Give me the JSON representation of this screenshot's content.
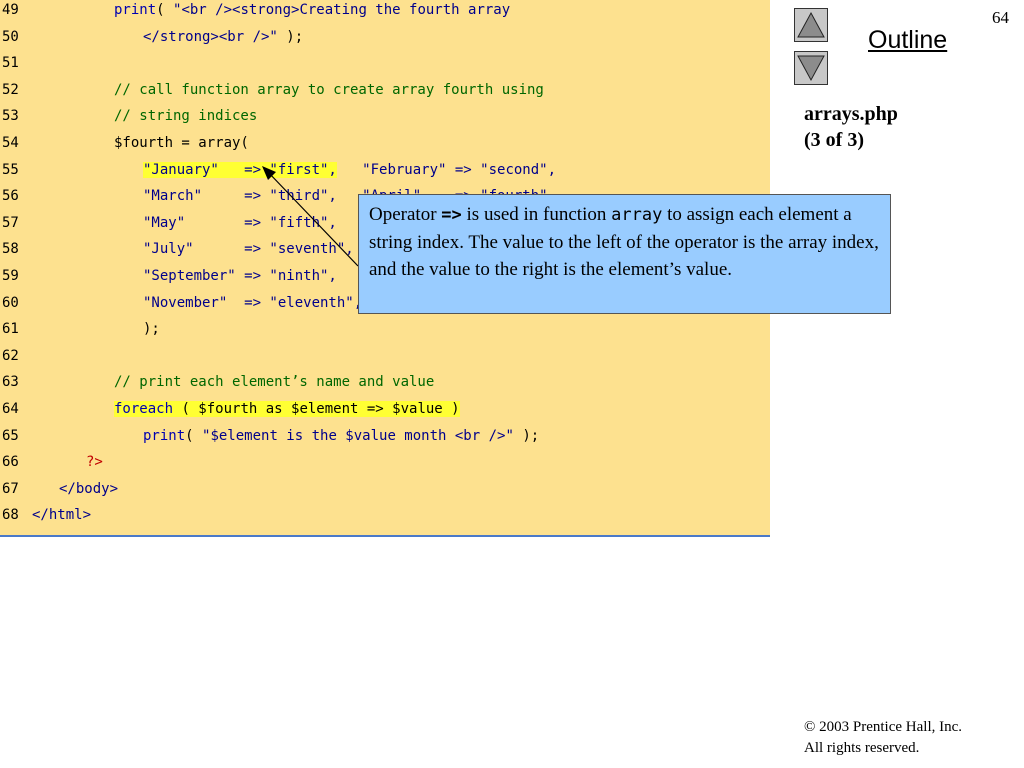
{
  "slide": {
    "page_number": "64",
    "outline_link": "Outline",
    "file_title_line1": "arrays.php",
    "file_title_line2": "(3 of 3)",
    "copyright_line1": "© 2003 Prentice Hall, Inc.",
    "copyright_line2": "All rights reserved."
  },
  "nav": {
    "up_icon": "triangle-up-icon",
    "down_icon": "triangle-down-icon"
  },
  "callout": {
    "part1": "Operator ",
    "operator": "=>",
    "part2": " is used in function ",
    "function_name": "array",
    "part3": " to assign each element a string index. The value to the left of the operator is the array index, and the value to the right is the element’s value."
  },
  "code": {
    "lines": [
      {
        "n": "49",
        "s": [
          {
            "t": "print",
            "c": "kw"
          },
          {
            "t": "( ",
            "c": "plain"
          },
          {
            "t": "\"<br /><strong>Creating the fourth array",
            "c": "str"
          }
        ]
      },
      {
        "n": "50",
        "s": [
          {
            "t": "</strong><br />\"",
            "c": "str"
          },
          {
            "t": " );",
            "c": "plain"
          }
        ]
      },
      {
        "n": "51",
        "s": []
      },
      {
        "n": "52",
        "s": [
          {
            "t": "// call function array to create array fourth using",
            "c": "cmt"
          }
        ]
      },
      {
        "n": "53",
        "s": [
          {
            "t": "// string indices",
            "c": "cmt"
          }
        ]
      },
      {
        "n": "54",
        "s": [
          {
            "t": "$fourth = array(",
            "c": "plain"
          }
        ]
      },
      {
        "n": "55",
        "s": [
          {
            "t": "\"January\"   => \"first\",",
            "c": "str"
          },
          {
            "t": "   \"February\" => \"second\",",
            "c": "str"
          }
        ]
      },
      {
        "n": "56",
        "s": [
          {
            "t": "\"March\"     => \"third\",   \"April\"    => \"fourth\",",
            "c": "str"
          }
        ]
      },
      {
        "n": "57",
        "s": [
          {
            "t": "\"May\"       => \"fifth\",   \"June\"     => \"sixth\",",
            "c": "str"
          }
        ]
      },
      {
        "n": "58",
        "s": [
          {
            "t": "\"July\"      => \"seventh\", \"August\"   => \"eighth\",",
            "c": "str"
          }
        ]
      },
      {
        "n": "59",
        "s": [
          {
            "t": "\"September\" => \"ninth\",   \"October\"  => \"tenth\",",
            "c": "str"
          }
        ]
      },
      {
        "n": "60",
        "s": [
          {
            "t": "\"November\"  => \"eleventh\",\"December\" => \"twelfth\"",
            "c": "str"
          }
        ]
      },
      {
        "n": "61",
        "s": [
          {
            "t": ");",
            "c": "plain"
          }
        ]
      },
      {
        "n": "62",
        "s": []
      },
      {
        "n": "63",
        "s": [
          {
            "t": "// print each element’s name and value",
            "c": "cmt"
          }
        ]
      },
      {
        "n": "64",
        "s": [
          {
            "t": "foreach",
            "c": "kw"
          },
          {
            "t": " ( $fourth as $element => $value )",
            "c": "plain"
          }
        ]
      },
      {
        "n": "65",
        "s": [
          {
            "t": "print",
            "c": "kw"
          },
          {
            "t": "( ",
            "c": "plain"
          },
          {
            "t": "\"$element is the $value month <br />\"",
            "c": "str"
          },
          {
            "t": " );",
            "c": "plain"
          }
        ]
      },
      {
        "n": "66",
        "s": [
          {
            "t": "?>",
            "c": "php"
          }
        ]
      },
      {
        "n": "67",
        "s": [
          {
            "t": "</body>",
            "c": "tag"
          }
        ]
      },
      {
        "n": "68",
        "s": [
          {
            "t": "</html>",
            "c": "tag"
          }
        ]
      }
    ]
  }
}
